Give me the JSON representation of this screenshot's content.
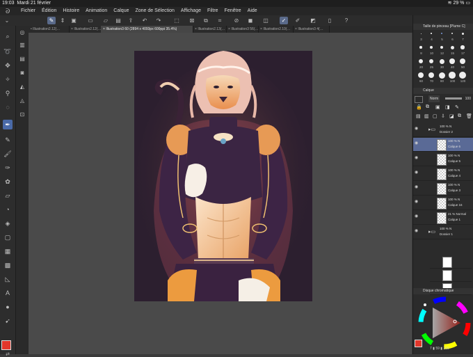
{
  "status": {
    "time": "19:03",
    "date": "Mardi 21 février",
    "battery": "29 %"
  },
  "menu": {
    "items": [
      "Fichier",
      "Édition",
      "Histoire",
      "Animation",
      "Calque",
      "Zone de Sélection",
      "Affichage",
      "Filtre",
      "Fenêtre",
      "Aide"
    ]
  },
  "tabs": [
    {
      "label": "Illustration2.12(…"
    },
    {
      "label": "Illustration2.12(…"
    },
    {
      "label": "Illustration3 60 (2894 x 4093px 600ppi 35.4%)"
    },
    {
      "label": "Illustration2.13(…"
    },
    {
      "label": "Illustration3 56(…"
    },
    {
      "label": "Illustration2.10(…"
    },
    {
      "label": "Illustration3 4(…"
    }
  ],
  "brush_panel": {
    "title": "Taille de pinceau [Plume C]",
    "sizes_row1": [
      "3",
      "4",
      "5",
      "6",
      "7"
    ],
    "sizes_row2": [
      "8",
      "10",
      "12",
      "15",
      "17"
    ],
    "sizes_row3": [
      "20",
      "25",
      "30",
      "40",
      "50"
    ],
    "sizes_row4": [
      "60",
      "70",
      "80",
      "100",
      "120"
    ]
  },
  "layer_panel": {
    "title": "Calque",
    "blend_mode": "Norm",
    "opacity": "100",
    "layers": [
      {
        "opacity": "100 %",
        "mode": "N",
        "name": "Dossier 2",
        "type": "folder"
      },
      {
        "opacity": "100 %",
        "mode": "N",
        "name": "Calque 6",
        "type": "layer",
        "selected": true
      },
      {
        "opacity": "100 %",
        "mode": "N",
        "name": "Calque 5",
        "type": "layer"
      },
      {
        "opacity": "100 %",
        "mode": "N",
        "name": "Calque 4",
        "type": "layer"
      },
      {
        "opacity": "100 %",
        "mode": "N",
        "name": "Calque 3",
        "type": "layer"
      },
      {
        "opacity": "100 %",
        "mode": "N",
        "name": "Calque 16",
        "type": "layer"
      },
      {
        "opacity": "21 %",
        "mode": "Normal",
        "name": "Calque 1",
        "type": "layer"
      },
      {
        "opacity": "100 %",
        "mode": "N",
        "name": "Dossier 1",
        "type": "folder"
      }
    ]
  },
  "color_panel": {
    "title": "Disque chromatique",
    "readout_a": "7",
    "readout_b": "59",
    "readout_c": "100",
    "main_color": "#e2362b"
  }
}
